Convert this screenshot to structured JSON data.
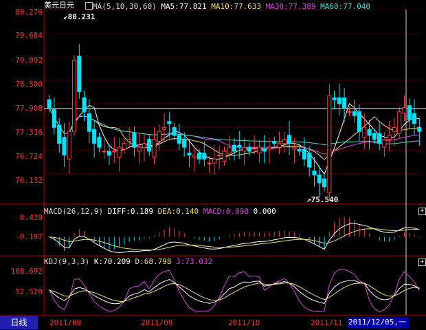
{
  "chart_data": {
    "type": "candlestick",
    "symbol": "美元日元",
    "ma_header": {
      "label": "MA(5,10,30,60)",
      "ma5": "MA5:77.821",
      "ma10": "MA10:77.633",
      "ma30": "MA30:77.389",
      "ma60": "MA60:77.040"
    },
    "y_ticks": [
      "80.276",
      "79.684",
      "79.092",
      "78.500",
      "77.908",
      "77.316",
      "76.724",
      "76.132"
    ],
    "ylim": [
      75.5,
      80.276
    ],
    "x_ticks": [
      "2011/08",
      "2011/09",
      "2011/10",
      "2011/11"
    ],
    "high_marker": "80.231",
    "low_marker": "75.540",
    "macd": {
      "label": "MACD(26,12,9)",
      "diff": "DIFF:0.189",
      "dea": "DEA:0.140",
      "macd": "MACD:0.098",
      "zero": "0.000",
      "y_ticks": [
        "0.439",
        "-0.197"
      ]
    },
    "kdj": {
      "label": "KDJ(9,3,3)",
      "k": "K:70.209",
      "d": "D:68.798",
      "j": "J:73.032",
      "y_ticks": [
        "108.692",
        "52.520"
      ]
    },
    "closes": [
      77.8,
      77.3,
      76.9,
      76.6,
      77.2,
      79.0,
      78.2,
      77.7,
      77.2,
      76.9,
      76.8,
      76.7,
      76.6,
      76.7,
      76.8,
      76.9,
      77.0,
      76.8,
      76.8,
      76.9,
      76.7,
      77.0,
      77.2,
      77.3,
      77.4,
      77.1,
      76.9,
      76.8,
      76.6,
      76.6,
      76.5,
      76.5,
      76.4,
      76.5,
      76.6,
      76.7,
      76.8,
      76.7,
      76.8,
      76.8,
      76.7,
      76.8,
      76.8,
      76.7,
      76.8,
      76.9,
      76.9,
      77.0,
      76.9,
      76.8,
      76.7,
      76.5,
      76.3,
      76.1,
      75.9,
      75.8,
      78.1,
      78.0,
      77.9,
      77.8,
      77.7,
      77.6,
      77.2,
      77.3,
      77.1,
      77.0,
      76.9,
      77.0,
      77.1,
      77.3,
      77.7,
      77.8,
      77.5,
      77.4,
      77.2
    ],
    "colors": {
      "up": "#ff4040",
      "down": "#00e5ff",
      "ma5": "#ffffff",
      "ma10": "#f0e060",
      "ma30": "#e040e0",
      "ma60": "#40e0d0",
      "axis": "#c00000",
      "label": "#ff3030"
    }
  },
  "footer": {
    "period_tab": "日线",
    "current_date": "2011/12/05,一"
  }
}
